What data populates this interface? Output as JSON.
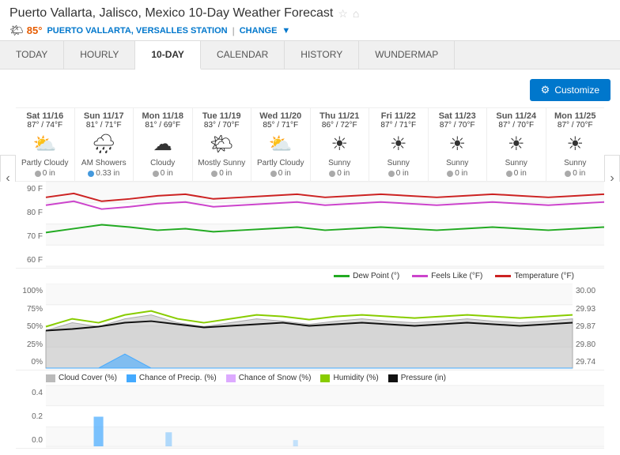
{
  "header": {
    "title": "Puerto Vallarta, Jalisco, Mexico 10-Day Weather Forecast",
    "temp": "85°",
    "station": "PUERTO VALLARTA, VERSALLES STATION",
    "change_label": "CHANGE"
  },
  "nav": {
    "tabs": [
      "TODAY",
      "HOURLY",
      "10-DAY",
      "CALENDAR",
      "HISTORY",
      "WUNDERMAP"
    ],
    "active": "10-DAY"
  },
  "toolbar": {
    "customize_label": "Customize"
  },
  "forecast": {
    "days": [
      {
        "date": "Sat 11/16",
        "high": "87°",
        "low": "74°F",
        "icon": "⛅",
        "condition": "Partly Cloudy",
        "precip": "0 in",
        "precip_type": "gray"
      },
      {
        "date": "Sun 11/17",
        "high": "81°",
        "low": "71°F",
        "icon": "🌧",
        "condition": "AM Showers",
        "precip": "0.33 in",
        "precip_type": "blue"
      },
      {
        "date": "Mon 11/18",
        "high": "81°",
        "low": "69°F",
        "icon": "☁",
        "condition": "Cloudy",
        "precip": "0 in",
        "precip_type": "gray"
      },
      {
        "date": "Tue 11/19",
        "high": "83°",
        "low": "70°F",
        "icon": "🌤",
        "condition": "Mostly Sunny",
        "precip": "0 in",
        "precip_type": "gray"
      },
      {
        "date": "Wed 11/20",
        "high": "85°",
        "low": "71°F",
        "icon": "⛅",
        "condition": "Partly Cloudy",
        "precip": "0 in",
        "precip_type": "gray"
      },
      {
        "date": "Thu 11/21",
        "high": "86°",
        "low": "72°F",
        "icon": "☀",
        "condition": "Sunny",
        "precip": "0 in",
        "precip_type": "gray"
      },
      {
        "date": "Fri 11/22",
        "high": "87°",
        "low": "71°F",
        "icon": "☀",
        "condition": "Sunny",
        "precip": "0 in",
        "precip_type": "gray"
      },
      {
        "date": "Sat 11/23",
        "high": "87°",
        "low": "70°F",
        "icon": "☀",
        "condition": "Sunny",
        "precip": "0 in",
        "precip_type": "gray"
      },
      {
        "date": "Sun 11/24",
        "high": "87°",
        "low": "70°F",
        "icon": "☀",
        "condition": "Sunny",
        "precip": "0 in",
        "precip_type": "gray"
      },
      {
        "date": "Mon 11/25",
        "high": "87°",
        "low": "70°F",
        "icon": "☀",
        "condition": "Sunny",
        "precip": "0 in",
        "precip_type": "gray"
      }
    ]
  },
  "temp_chart": {
    "y_labels": [
      "90 F",
      "80 F",
      "70 F",
      "60 F"
    ],
    "legend": [
      {
        "label": "Dew Point (°)",
        "color": "#22aa22"
      },
      {
        "label": "Feels Like (°F)",
        "color": "#cc44cc"
      },
      {
        "label": "Temperature (°F)",
        "color": "#cc2222"
      }
    ]
  },
  "precip_chart": {
    "y_labels_left": [
      "100%",
      "75%",
      "50%",
      "25%",
      "0%"
    ],
    "y_labels_right": [
      "30.00",
      "29.93",
      "29.87",
      "29.80",
      "29.74"
    ],
    "legend": [
      {
        "label": "Cloud Cover (%)",
        "color": "#bbbbbb"
      },
      {
        "label": "Chance of Precip. (%)",
        "color": "#44aaff"
      },
      {
        "label": "Chance of Snow (%)",
        "color": "#ddaaff"
      },
      {
        "label": "Humidity (%)",
        "color": "#88cc00"
      },
      {
        "label": "Pressure (in)",
        "color": "#111111"
      }
    ]
  },
  "rain_chart": {
    "y_labels": [
      "0.4",
      "0.2",
      "0.0"
    ]
  }
}
